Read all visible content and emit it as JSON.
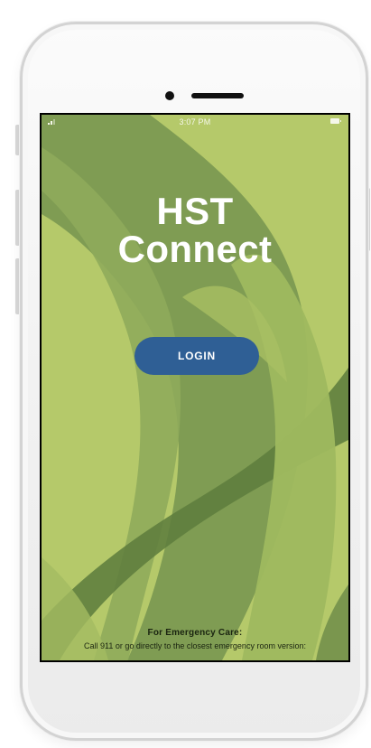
{
  "status_bar": {
    "time": "3:07 PM"
  },
  "app": {
    "title_line1": "HST",
    "title_line2": "Connect",
    "login_label": "LOGIN",
    "emergency_title": "For Emergency Care:",
    "emergency_text": "Call 911 or go directly to the closest emergency room version:"
  },
  "colors": {
    "background": "#b5c96a",
    "accent_green": "#7c9a52",
    "dark_green": "#5e7d3e",
    "login_button": "#2f5f95"
  },
  "icons": {
    "signal": "signal-icon",
    "battery": "battery-icon"
  }
}
